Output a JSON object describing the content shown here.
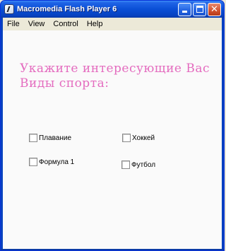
{
  "window": {
    "title": "Macromedia Flash Player 6"
  },
  "menu": [
    "File",
    "View",
    "Control",
    "Help"
  ],
  "content": {
    "question_line1": "Укажите интересующие Вас",
    "question_line2": "Виды спорта:",
    "options": [
      {
        "label": "Плавание",
        "checked": false
      },
      {
        "label": "Хоккей",
        "checked": false
      },
      {
        "label": "Формула 1",
        "checked": false
      },
      {
        "label": "Футбол",
        "checked": false
      }
    ]
  },
  "colors": {
    "title_bar": "#0a4fd6",
    "question_text": "#e46cbf",
    "background": "#fafafa"
  },
  "icons": {
    "app": "flash-icon",
    "minimize": "minimize-icon",
    "maximize": "maximize-icon",
    "close": "close-icon"
  }
}
